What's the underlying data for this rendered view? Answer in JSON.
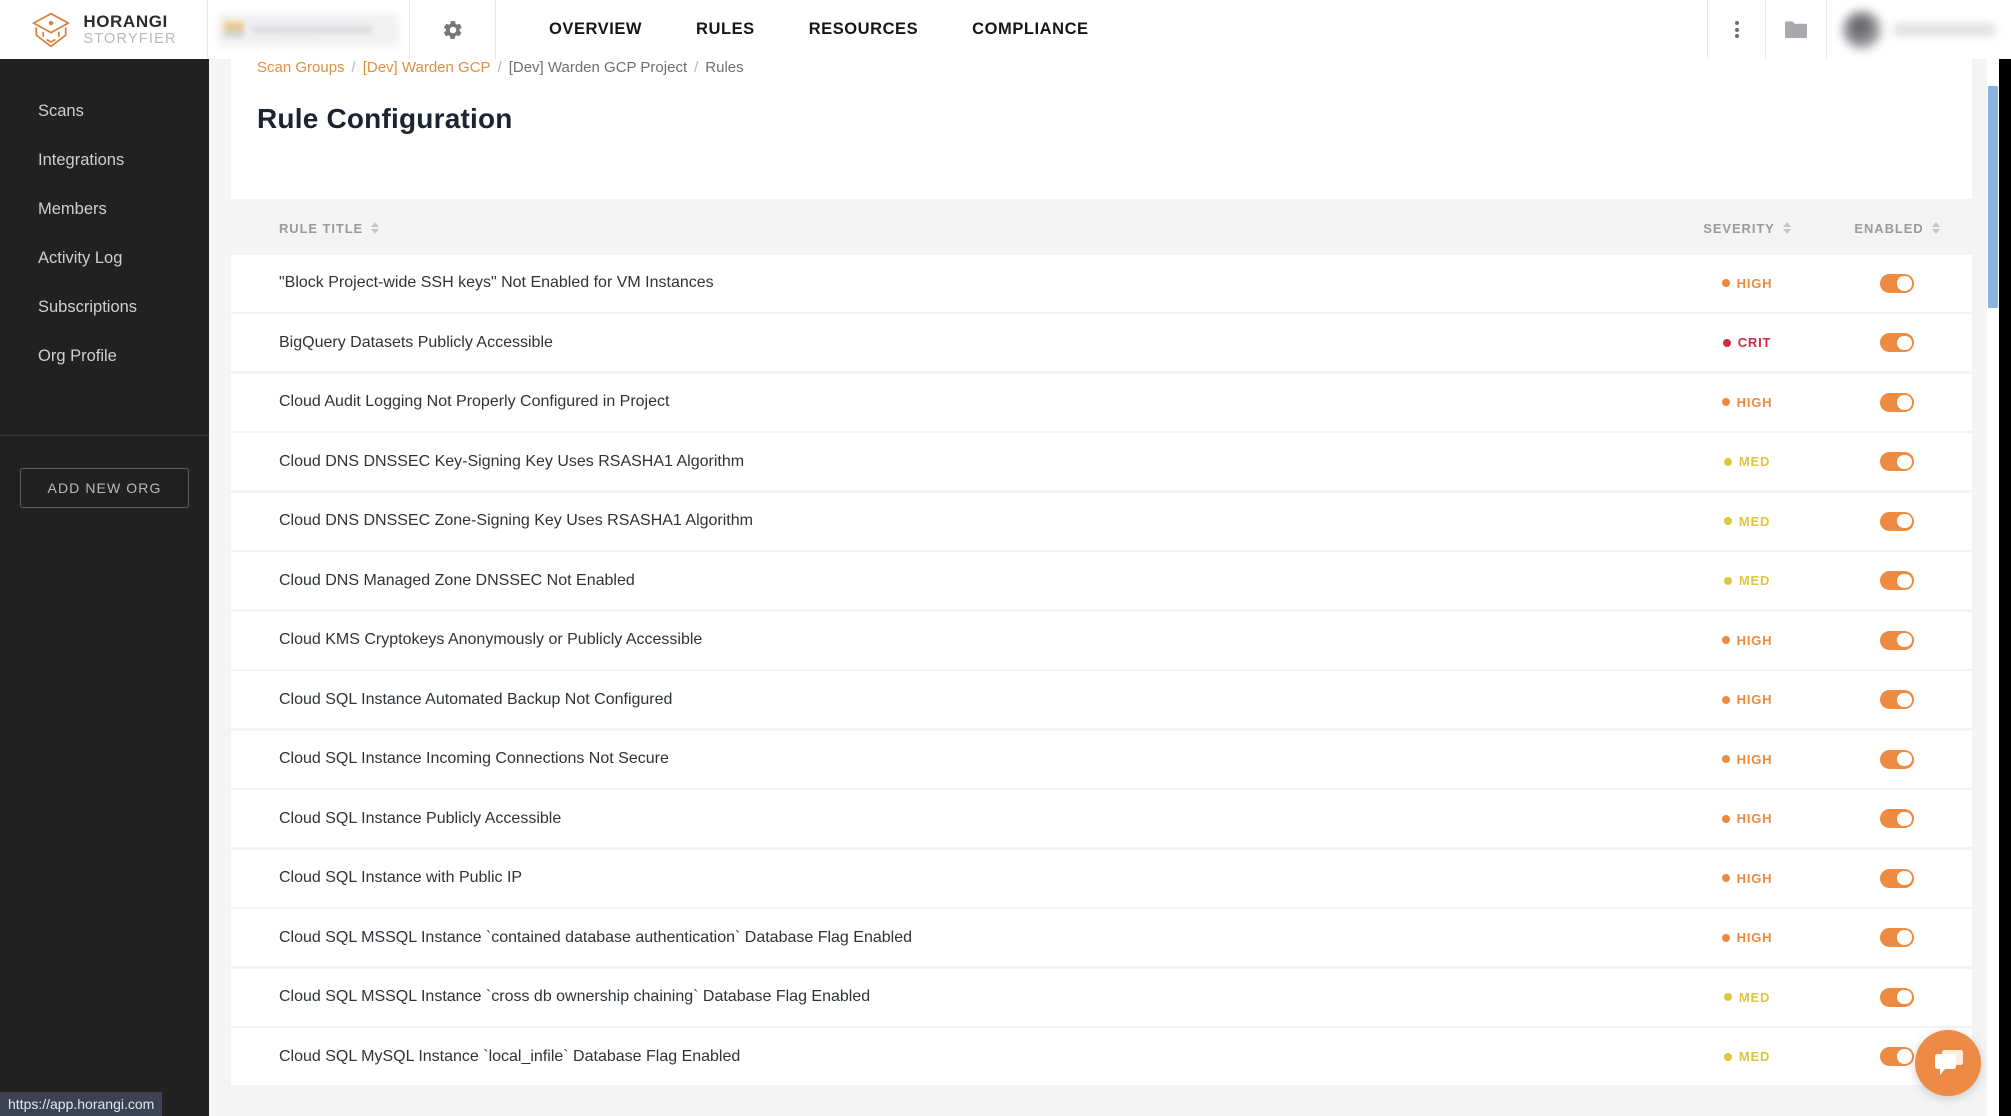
{
  "header": {
    "brand": {
      "name": "HORANGI",
      "tagline": "STORYFIER",
      "icon": "horangi-tiger-logo"
    },
    "omnibox": {
      "value": "",
      "placeholder": ""
    },
    "gear_icon": "gear-icon",
    "nav_tabs": [
      {
        "label": "OVERVIEW",
        "active": false
      },
      {
        "label": "RULES",
        "active": true
      },
      {
        "label": "RESOURCES",
        "active": false
      },
      {
        "label": "COMPLIANCE",
        "active": false
      }
    ],
    "kebab_icon": "more-vertical-icon",
    "folder_icon": "folder-icon",
    "user": {
      "name": "",
      "avatar": "user-avatar"
    }
  },
  "sidebar": {
    "items": [
      {
        "label": "Scans"
      },
      {
        "label": "Integrations"
      },
      {
        "label": "Members"
      },
      {
        "label": "Activity Log"
      },
      {
        "label": "Subscriptions"
      },
      {
        "label": "Org Profile"
      }
    ],
    "add_org_label": "ADD NEW ORG"
  },
  "breadcrumb": {
    "items": [
      {
        "label": "Scan Groups",
        "link": true
      },
      {
        "label": "[Dev] Warden GCP",
        "link": true
      },
      {
        "label": "[Dev] Warden GCP Project",
        "link": false
      },
      {
        "label": "Rules",
        "link": false
      }
    ],
    "separator": "/"
  },
  "page": {
    "title": "Rule Configuration"
  },
  "table": {
    "columns": [
      {
        "key": "title",
        "label": "RULE TITLE",
        "sortable": true
      },
      {
        "key": "severity",
        "label": "SEVERITY",
        "sortable": true
      },
      {
        "key": "enabled",
        "label": "ENABLED",
        "sortable": true
      }
    ],
    "rows": [
      {
        "title": "\"Block Project-wide SSH keys\" Not Enabled for VM Instances",
        "severity": "HIGH",
        "enabled": true
      },
      {
        "title": "BigQuery Datasets Publicly Accessible",
        "severity": "CRIT",
        "enabled": true
      },
      {
        "title": "Cloud Audit Logging Not Properly Configured in Project",
        "severity": "HIGH",
        "enabled": true
      },
      {
        "title": "Cloud DNS DNSSEC Key-Signing Key Uses RSASHA1 Algorithm",
        "severity": "MED",
        "enabled": true
      },
      {
        "title": "Cloud DNS DNSSEC Zone-Signing Key Uses RSASHA1 Algorithm",
        "severity": "MED",
        "enabled": true
      },
      {
        "title": "Cloud DNS Managed Zone DNSSEC Not Enabled",
        "severity": "MED",
        "enabled": true
      },
      {
        "title": "Cloud KMS Cryptokeys Anonymously or Publicly Accessible",
        "severity": "HIGH",
        "enabled": true
      },
      {
        "title": "Cloud SQL Instance Automated Backup Not Configured",
        "severity": "HIGH",
        "enabled": true
      },
      {
        "title": "Cloud SQL Instance Incoming Connections Not Secure",
        "severity": "HIGH",
        "enabled": true
      },
      {
        "title": "Cloud SQL Instance Publicly Accessible",
        "severity": "HIGH",
        "enabled": true
      },
      {
        "title": "Cloud SQL Instance with Public IP",
        "severity": "HIGH",
        "enabled": true
      },
      {
        "title": "Cloud SQL MSSQL Instance `contained database authentication` Database Flag Enabled",
        "severity": "HIGH",
        "enabled": true
      },
      {
        "title": "Cloud SQL MSSQL Instance `cross db ownership chaining` Database Flag Enabled",
        "severity": "MED",
        "enabled": true
      },
      {
        "title": "Cloud SQL MySQL Instance `local_infile` Database Flag Enabled",
        "severity": "MED",
        "enabled": true
      }
    ]
  },
  "severity_colors": {
    "CRIT": "#d32b45",
    "HIGH": "#ee8a3e",
    "MED": "#e0c53f"
  },
  "colors": {
    "accent": "#ed8b46",
    "toggle_on": "#ee8b42",
    "sidebar_bg": "#212121",
    "content_bg": "#f4f4f4",
    "scrollbar_thumb": "#8ab4de"
  },
  "chat_widget": {
    "icon": "chat-bubbles-icon"
  },
  "status_bar": {
    "url": "https://app.horangi.com"
  }
}
